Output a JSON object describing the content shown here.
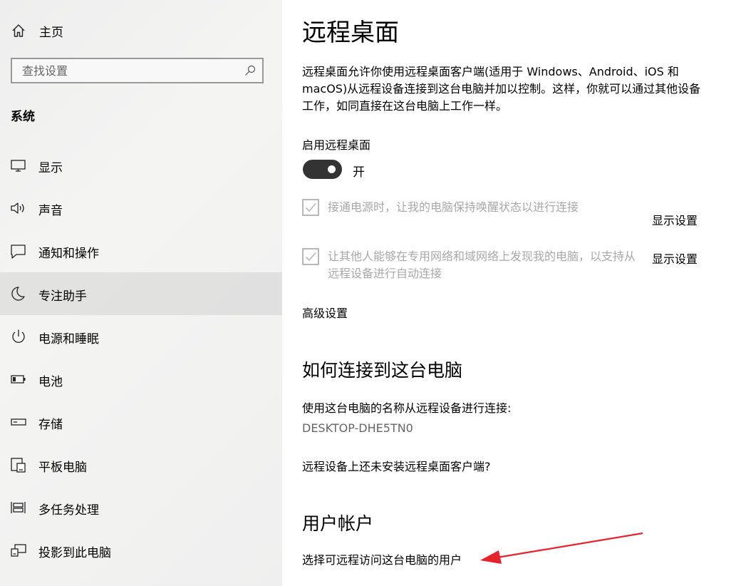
{
  "sidebar": {
    "home_label": "主页",
    "search_placeholder": "查找设置",
    "section_title": "系统",
    "items": [
      {
        "label": "显示",
        "icon": "monitor-icon"
      },
      {
        "label": "声音",
        "icon": "speaker-icon"
      },
      {
        "label": "通知和操作",
        "icon": "message-icon"
      },
      {
        "label": "专注助手",
        "icon": "moon-icon",
        "selected": true
      },
      {
        "label": "电源和睡眠",
        "icon": "power-icon"
      },
      {
        "label": "电池",
        "icon": "battery-icon"
      },
      {
        "label": "存储",
        "icon": "storage-icon"
      },
      {
        "label": "平板电脑",
        "icon": "tablet-icon"
      },
      {
        "label": "多任务处理",
        "icon": "multitask-icon"
      },
      {
        "label": "投影到此电脑",
        "icon": "project-icon"
      }
    ]
  },
  "main": {
    "title": "远程桌面",
    "description": "远程桌面允许你使用远程桌面客户端(适用于 Windows、Android、iOS 和 macOS)从远程设备连接到这台电脑并加以控制。这样，你就可以通过其他设备工作，如同直接在这台电脑上工作一样。",
    "enable_label": "启用远程桌面",
    "toggle_state": "开",
    "toggle_on": true,
    "options": [
      {
        "text": "接通电源时，让我的电脑保持唤醒状态以进行连接",
        "checked": true,
        "link": "显示设置"
      },
      {
        "text": "让其他人能够在专用网络和域网络上发现我的电脑，以支持从远程设备进行自动连接",
        "checked": true,
        "link": "显示设置"
      }
    ],
    "advanced_link": "高级设置",
    "connect_heading": "如何连接到这台电脑",
    "connect_desc": "使用这台电脑的名称从远程设备进行连接:",
    "pc_name": "DESKTOP-DHE5TN0",
    "no_client_link": "远程设备上还未安装远程桌面客户端?",
    "accounts_heading": "用户帐户",
    "select_users_link": "选择可远程访问这台电脑的用户"
  },
  "colors": {
    "annotation_arrow": "#e8212a",
    "toggle_on": "#333333",
    "disabled_text": "#a8a8a8"
  }
}
